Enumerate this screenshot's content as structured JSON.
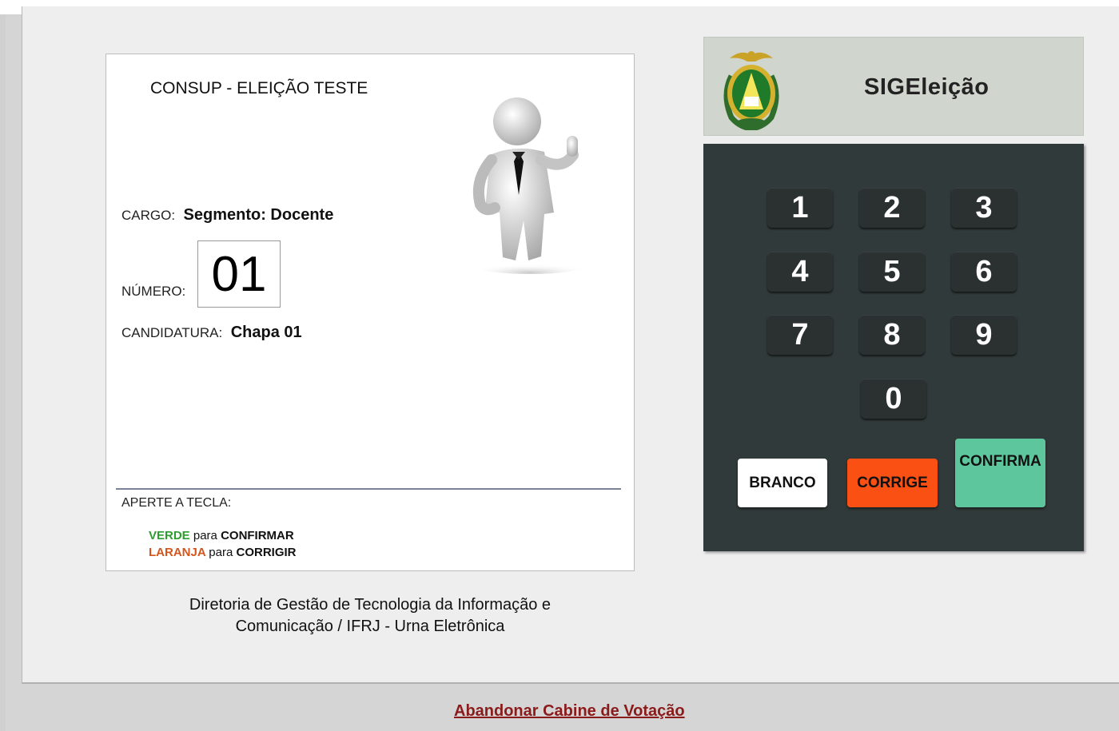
{
  "screen": {
    "election_title": "CONSUP - ELEIÇÃO TESTE",
    "cargo_label": "CARGO:",
    "cargo_value": "Segmento: Docente",
    "numero_label": "NÚMERO:",
    "numero_value": "01",
    "candidatura_label": "CANDIDATURA:",
    "candidatura_value": "Chapa 01",
    "aperte_label": "APERTE A TECLA:",
    "instr_verde_color": "VERDE",
    "instr_verde_para": "para",
    "instr_verde_action": "CONFIRMAR",
    "instr_laranja_color": "LARANJA",
    "instr_laranja_para": "para",
    "instr_laranja_action": "CORRIGIR"
  },
  "footer": {
    "line1": "Diretoria de Gestão de Tecnologia da Informação e",
    "line2": "Comunicação / IFRJ - Urna Eletrônica"
  },
  "header": {
    "title": "SIGEleição"
  },
  "keypad": {
    "keys": [
      "1",
      "2",
      "3",
      "4",
      "5",
      "6",
      "7",
      "8",
      "9",
      "0"
    ],
    "branco": "BRANCO",
    "corrige": "CORRIGE",
    "confirma": "CONFIRMA"
  },
  "colors": {
    "green": "#2e9c2e",
    "orange": "#d4551c",
    "corrige_bg": "#fa5014",
    "confirma_bg": "#5dc69c",
    "keypad_bg": "#313a3a"
  },
  "link": {
    "abandon": "Abandonar Cabine de Votação"
  }
}
